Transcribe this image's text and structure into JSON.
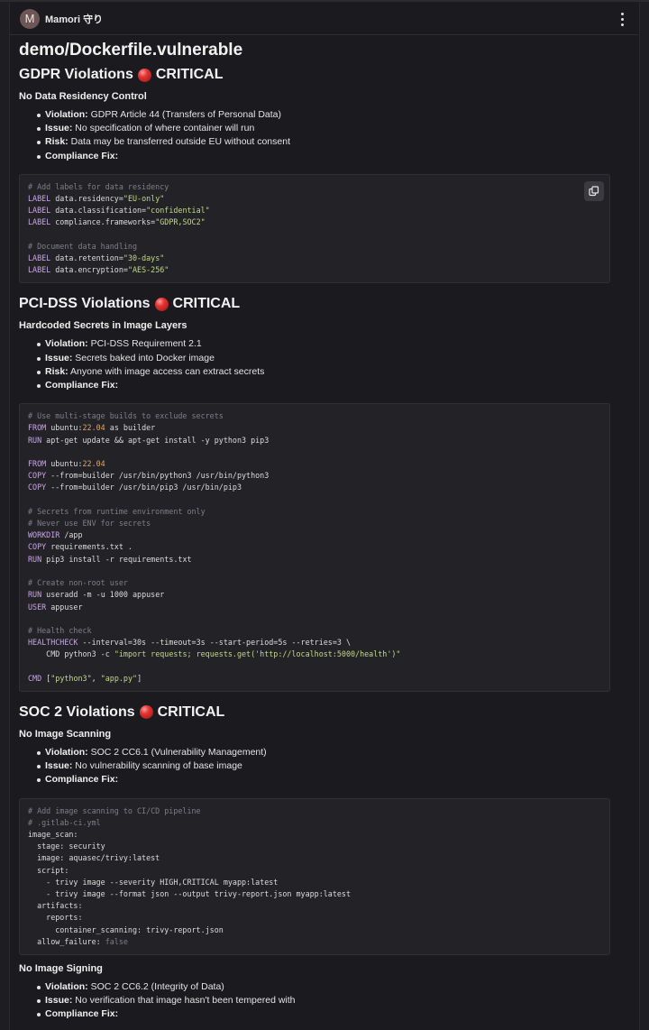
{
  "header": {
    "avatar_letter": "M",
    "username": "Mamori 守り"
  },
  "page": {
    "title": "demo/Dockerfile.vulnerable"
  },
  "sections": [
    {
      "title": "GDPR Violations",
      "badge": "CRITICAL",
      "subtitle": "No Data Residency Control",
      "bullets": [
        {
          "label": "Violation:",
          "text": "GDPR Article 44 (Transfers of Personal Data)"
        },
        {
          "label": "Issue:",
          "text": "No specification of where container will run"
        },
        {
          "label": "Risk:",
          "text": "Data may be transferred outside EU without consent"
        },
        {
          "label": "Compliance Fix:",
          "text": ""
        }
      ]
    },
    {
      "title": "PCI-DSS Violations",
      "badge": "CRITICAL",
      "subtitle": "Hardcoded Secrets in Image Layers",
      "bullets": [
        {
          "label": "Violation:",
          "text": "PCI-DSS Requirement 2.1"
        },
        {
          "label": "Issue:",
          "text": "Secrets baked into Docker image"
        },
        {
          "label": "Risk:",
          "text": "Anyone with image access can extract secrets"
        },
        {
          "label": "Compliance Fix:",
          "text": ""
        }
      ]
    },
    {
      "title": "SOC 2 Violations",
      "badge": "CRITICAL",
      "subtitle": "No Image Scanning",
      "bullets": [
        {
          "label": "Violation:",
          "text": "SOC 2 CC6.1 (Vulnerability Management)"
        },
        {
          "label": "Issue:",
          "text": "No vulnerability scanning of base image"
        },
        {
          "label": "Compliance Fix:",
          "text": ""
        }
      ],
      "subtitle2": "No Image Signing",
      "bullets2": [
        {
          "label": "Violation:",
          "text": "SOC 2 CC6.2 (Integrity of Data)"
        },
        {
          "label": "Issue:",
          "text": "No verification that image hasn't been tempered with"
        },
        {
          "label": "Compliance Fix:",
          "text": ""
        }
      ]
    }
  ],
  "code_blocks": [
    [
      [
        [
          "com",
          "# Add labels for data residency"
        ]
      ],
      [
        [
          "kw",
          "LABEL"
        ],
        [
          "t",
          " data.residency="
        ],
        [
          "str",
          "\"EU-only\""
        ]
      ],
      [
        [
          "kw",
          "LABEL"
        ],
        [
          "t",
          " data.classification="
        ],
        [
          "str",
          "\"confidential\""
        ]
      ],
      [
        [
          "kw",
          "LABEL"
        ],
        [
          "t",
          " compliance.frameworks="
        ],
        [
          "str",
          "\"GDPR,SOC2\""
        ]
      ],
      [],
      [
        [
          "com",
          "# Document data handling"
        ]
      ],
      [
        [
          "kw",
          "LABEL"
        ],
        [
          "t",
          " data.retention="
        ],
        [
          "str",
          "\"30-days\""
        ]
      ],
      [
        [
          "kw",
          "LABEL"
        ],
        [
          "t",
          " data.encryption="
        ],
        [
          "str",
          "\"AES-256\""
        ]
      ]
    ],
    [
      [
        [
          "com",
          "# Use multi-stage builds to exclude secrets"
        ]
      ],
      [
        [
          "kw",
          "FROM"
        ],
        [
          "t",
          " ubuntu:"
        ],
        [
          "num",
          "22.04"
        ],
        [
          "t",
          " as builder"
        ]
      ],
      [
        [
          "kw",
          "RUN"
        ],
        [
          "t",
          " apt-get update && apt-get install -y python3 pip3"
        ]
      ],
      [],
      [
        [
          "kw",
          "FROM"
        ],
        [
          "t",
          " ubuntu:"
        ],
        [
          "num",
          "22.04"
        ]
      ],
      [
        [
          "kw",
          "COPY"
        ],
        [
          "t",
          " --from=builder /usr/bin/python3 /usr/bin/python3"
        ]
      ],
      [
        [
          "kw",
          "COPY"
        ],
        [
          "t",
          " --from=builder /usr/bin/pip3 /usr/bin/pip3"
        ]
      ],
      [],
      [
        [
          "com",
          "# Secrets from runtime environment only"
        ]
      ],
      [
        [
          "com",
          "# Never use ENV for secrets"
        ]
      ],
      [
        [
          "kw",
          "WORKDIR"
        ],
        [
          "t",
          " /app"
        ]
      ],
      [
        [
          "kw",
          "COPY"
        ],
        [
          "t",
          " requirements.txt ."
        ]
      ],
      [
        [
          "kw",
          "RUN"
        ],
        [
          "t",
          " pip3 install -r requirements.txt"
        ]
      ],
      [],
      [
        [
          "com",
          "# Create non-root user"
        ]
      ],
      [
        [
          "kw",
          "RUN"
        ],
        [
          "t",
          " useradd -m -u 1000 appuser"
        ]
      ],
      [
        [
          "kw",
          "USER"
        ],
        [
          "t",
          " appuser"
        ]
      ],
      [],
      [
        [
          "com",
          "# Health check"
        ]
      ],
      [
        [
          "kw",
          "HEALTHCHECK"
        ],
        [
          "t",
          " --interval=30s --timeout=3s --start-period=5s --retries=3 \\"
        ]
      ],
      [
        [
          "t",
          "    CMD python3 -c "
        ],
        [
          "str",
          "\"import requests; requests.get('http://localhost:5000/health')\""
        ]
      ],
      [],
      [
        [
          "kw",
          "CMD"
        ],
        [
          "t",
          " ["
        ],
        [
          "str",
          "\"python3\""
        ],
        [
          "t",
          ", "
        ],
        [
          "str",
          "\"app.py\""
        ],
        [
          "t",
          "]"
        ]
      ]
    ],
    [
      [
        [
          "com",
          "# Add image scanning to CI/CD pipeline"
        ]
      ],
      [
        [
          "com",
          "# .gitlab-ci.yml"
        ]
      ],
      [
        [
          "t",
          "image_scan:"
        ]
      ],
      [
        [
          "t",
          "  stage: security"
        ]
      ],
      [
        [
          "t",
          "  image: aquasec/trivy:latest"
        ]
      ],
      [
        [
          "t",
          "  script:"
        ]
      ],
      [
        [
          "t",
          "    - trivy image --severity HIGH,CRITICAL myapp:latest"
        ]
      ],
      [
        [
          "t",
          "    - trivy image --format json --output trivy-report.json myapp:latest"
        ]
      ],
      [
        [
          "t",
          "  artifacts:"
        ]
      ],
      [
        [
          "t",
          "    reports:"
        ]
      ],
      [
        [
          "t",
          "      container_scanning: trivy-report.json"
        ]
      ],
      [
        [
          "t",
          "  allow_failure: "
        ],
        [
          "com",
          "false"
        ]
      ]
    ]
  ],
  "icons": {
    "copy": "copy-icon",
    "menu": "kebab-menu-icon",
    "critical": "red-circle-icon"
  }
}
